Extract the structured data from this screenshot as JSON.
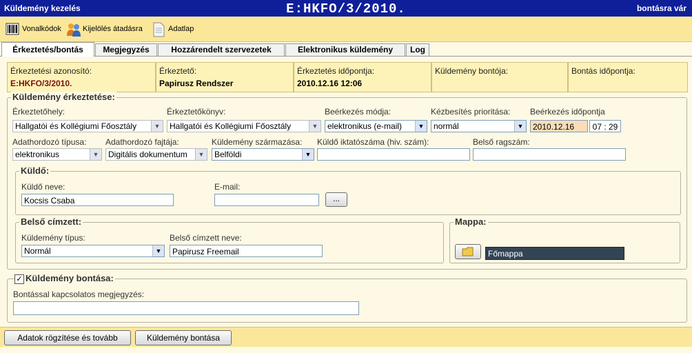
{
  "window": {
    "title_left": "Küldemény kezelés",
    "title_center": "E:HKFO/3/2010.",
    "title_right": "bontásra vár"
  },
  "toolbar": {
    "barcode": "Vonalkódok",
    "assign": "Kijelölés átadásra",
    "datasheet": "Adatlap"
  },
  "tabs": [
    "Érkeztetés/bontás",
    "Megjegyzés",
    "Hozzárendelt szervezetek",
    "Elektronikus küldemény",
    "Log"
  ],
  "info": [
    {
      "label": "Érkeztetési azonosító:",
      "value": "E:HKFO/3/2010."
    },
    {
      "label": "Érkeztető:",
      "value": "Papirusz Rendszer"
    },
    {
      "label": "Érkeztetés időpontja:",
      "value": "2010.12.16 12:06"
    },
    {
      "label": "Küldemény bontója:",
      "value": ""
    },
    {
      "label": "Bontás időpontja:",
      "value": ""
    }
  ],
  "arrival": {
    "legend": "Küldemény érkeztetése:",
    "place_label": "Érkeztetőhely:",
    "place_value": "Hallgatói és Kollégiumi Főosztály",
    "book_label": "Érkeztetőkönyv:",
    "book_value": "Hallgatói és Kollégiumi Főosztály",
    "mode_label": "Beérkezés módja:",
    "mode_value": "elektronikus (e-mail)",
    "priority_label": "Kézbesítés prioritása:",
    "priority_value": "normál",
    "time_label": "Beérkezés időpontja",
    "date_value": "2010.12.16",
    "time_value": "07 : 29",
    "carrier_type_label": "Adathordozó típusa:",
    "carrier_type_value": "elektronikus",
    "carrier_kind_label": "Adathordozó fajtája:",
    "carrier_kind_value": "Digitális dokumentum",
    "origin_label": "Küldemény származása:",
    "origin_value": "Belföldi",
    "sender_ref_label": "Küldő iktatószáma (hiv. szám):",
    "sender_ref_value": "",
    "internal_ref_label": "Belső ragszám:",
    "internal_ref_value": ""
  },
  "sender": {
    "legend": "Küldő:",
    "name_label": "Küldő neve:",
    "name_value": "Kocsis Csaba",
    "email_label": "E-mail:",
    "email_value": "",
    "browse": "..."
  },
  "recipient": {
    "legend": "Belső címzett:",
    "type_label": "Küldemény típus:",
    "type_value": "Normál",
    "name_label": "Belső címzett neve:",
    "name_value": "Papirusz Freemail"
  },
  "folder": {
    "legend": "Mappa:",
    "value": "Főmappa"
  },
  "opening": {
    "label": "Küldemény bontása:",
    "note_label": "Bontással kapcsolatos megjegyzés:",
    "note_value": "",
    "checked": true
  },
  "buttons": {
    "save": "Adatok rögzítése és tovább",
    "open": "Küldemény bontása"
  }
}
